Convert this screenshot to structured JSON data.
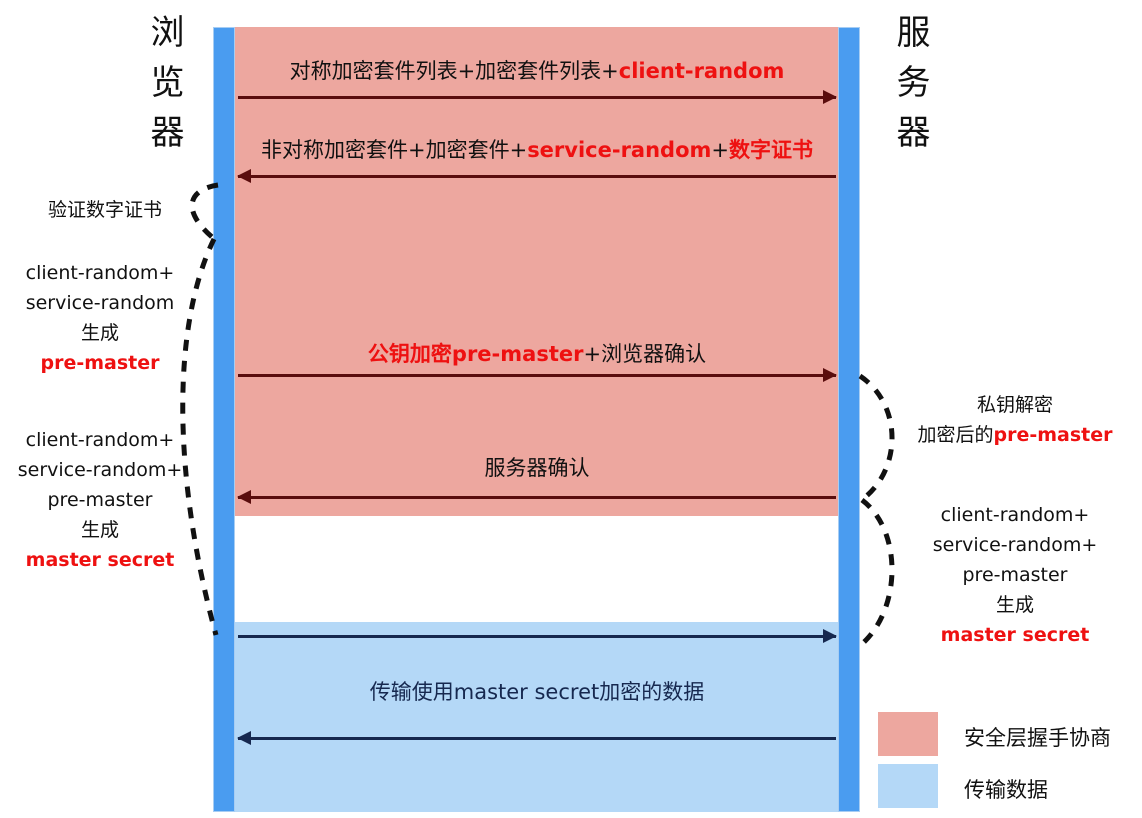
{
  "actors": {
    "left": "浏览器",
    "right": "服务器"
  },
  "messages": [
    {
      "id": "client-hello",
      "direction": "right",
      "text_plain_1": "对称加密套件列表+加密套件列表+",
      "text_highlight": "client-random",
      "text_plain_2": ""
    },
    {
      "id": "server-hello",
      "direction": "left",
      "text_plain_1": "非对称加密套件+加密套件+",
      "text_highlight": "service-random",
      "text_plain_2": "+",
      "text_highlight_2": "数字证书"
    },
    {
      "id": "client-key-exchange",
      "direction": "right",
      "text_highlight": "公钥加密pre-master",
      "text_plain_2": "+浏览器确认"
    },
    {
      "id": "server-finished",
      "direction": "left",
      "text_plain_1": "服务器确认"
    },
    {
      "id": "app-data-up",
      "direction": "right",
      "text_plain_1": ""
    },
    {
      "id": "app-data-label",
      "direction": "none",
      "text_plain_1": "传输使用master secret加密的数据"
    },
    {
      "id": "app-data-down",
      "direction": "left",
      "text_plain_1": ""
    }
  ],
  "notes": {
    "left_verify": {
      "lines": [
        "验证数字证书"
      ]
    },
    "left_premaster": {
      "lines": [
        "client-random+",
        "service-random",
        "生成"
      ],
      "red_line": "pre-master"
    },
    "left_mastersecret": {
      "lines": [
        "client-random+",
        "service-random+",
        "pre-master",
        "生成"
      ],
      "red_line": "master secret"
    },
    "right_decrypt": {
      "line1": "私钥解密",
      "line2_plain": "加密后的",
      "line2_red": "pre-master"
    },
    "right_mastersecret": {
      "lines": [
        "client-random+",
        "service-random+",
        "pre-master",
        "生成"
      ],
      "red_line": "master secret"
    }
  },
  "legend": [
    {
      "color": "#eda79f",
      "label": "安全层握手协商"
    },
    {
      "color": "#b4d8f7",
      "label": "传输数据"
    }
  ],
  "colors": {
    "handshake_band": "#eda79f",
    "data_band": "#b4d8f7",
    "lifeline": "#4a9cf0",
    "arrow_dark_red": "#5a0d0d",
    "arrow_navy": "#16284f",
    "highlight_red": "#ee1111"
  }
}
